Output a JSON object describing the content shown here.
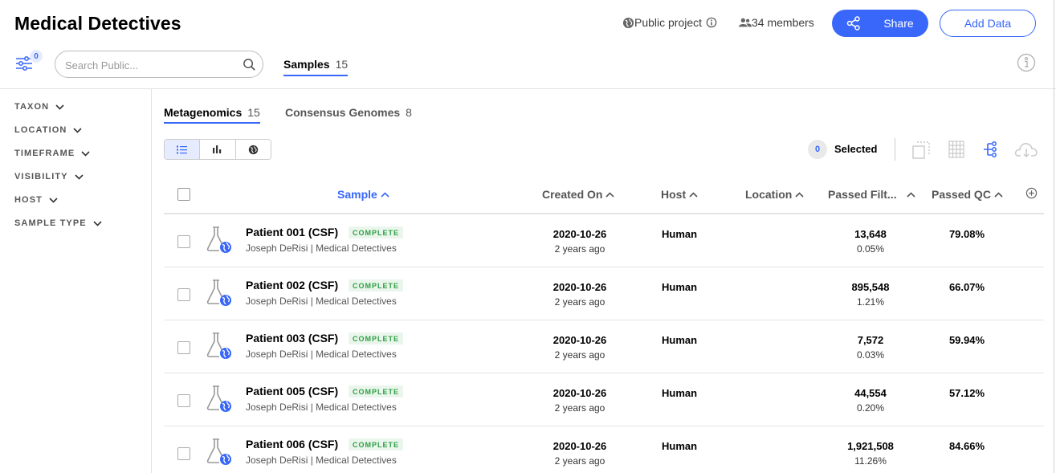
{
  "header": {
    "title": "Medical Detectives",
    "visibility": "Public project",
    "members": "34 members",
    "share_label": "Share",
    "add_data_label": "Add Data",
    "filter_count": "0",
    "search_placeholder": "Search Public...",
    "samples_tab": {
      "label": "Samples",
      "count": "15"
    }
  },
  "sidebar": {
    "filters": [
      "TAXON",
      "LOCATION",
      "TIMEFRAME",
      "VISIBILITY",
      "HOST",
      "SAMPLE TYPE"
    ]
  },
  "main": {
    "tabs": [
      {
        "label": "Metagenomics",
        "count": "15"
      },
      {
        "label": "Consensus Genomes",
        "count": "8"
      }
    ],
    "selected_count": "0",
    "selected_label": "Selected",
    "columns": [
      "Sample",
      "Created On",
      "Host",
      "Location",
      "Passed Filt...",
      "Passed QC"
    ],
    "rows": [
      {
        "name": "Patient 001 (CSF)",
        "status": "COMPLETE",
        "owner": "Joseph DeRisi | Medical Detectives",
        "created": "2020-10-26",
        "created_ago": "2 years ago",
        "host": "Human",
        "location": "",
        "passed_filters": "13,648",
        "passed_filters_pct": "0.05%",
        "passed_qc": "79.08%"
      },
      {
        "name": "Patient 002 (CSF)",
        "status": "COMPLETE",
        "owner": "Joseph DeRisi | Medical Detectives",
        "created": "2020-10-26",
        "created_ago": "2 years ago",
        "host": "Human",
        "location": "",
        "passed_filters": "895,548",
        "passed_filters_pct": "1.21%",
        "passed_qc": "66.07%"
      },
      {
        "name": "Patient 003 (CSF)",
        "status": "COMPLETE",
        "owner": "Joseph DeRisi | Medical Detectives",
        "created": "2020-10-26",
        "created_ago": "2 years ago",
        "host": "Human",
        "location": "",
        "passed_filters": "7,572",
        "passed_filters_pct": "0.03%",
        "passed_qc": "59.94%"
      },
      {
        "name": "Patient 005 (CSF)",
        "status": "COMPLETE",
        "owner": "Joseph DeRisi | Medical Detectives",
        "created": "2020-10-26",
        "created_ago": "2 years ago",
        "host": "Human",
        "location": "",
        "passed_filters": "44,554",
        "passed_filters_pct": "0.20%",
        "passed_qc": "57.12%"
      },
      {
        "name": "Patient 006 (CSF)",
        "status": "COMPLETE",
        "owner": "Joseph DeRisi | Medical Detectives",
        "created": "2020-10-26",
        "created_ago": "2 years ago",
        "host": "Human",
        "location": "",
        "passed_filters": "1,921,508",
        "passed_filters_pct": "11.26%",
        "passed_qc": "84.66%"
      }
    ]
  },
  "colors": {
    "accent": "#3867fa",
    "complete_text": "#2f9e44",
    "complete_bg": "#eaf6ec"
  },
  "icons": [
    "filter-sliders-icon",
    "search-icon",
    "globe-icon",
    "members-icon",
    "info-icon",
    "share-icon",
    "list-view-icon",
    "chart-view-icon",
    "map-view-icon",
    "select-bulk-icon",
    "heatmap-icon",
    "phylo-tree-icon",
    "download-cloud-icon",
    "add-column-icon",
    "flask-icon"
  ]
}
